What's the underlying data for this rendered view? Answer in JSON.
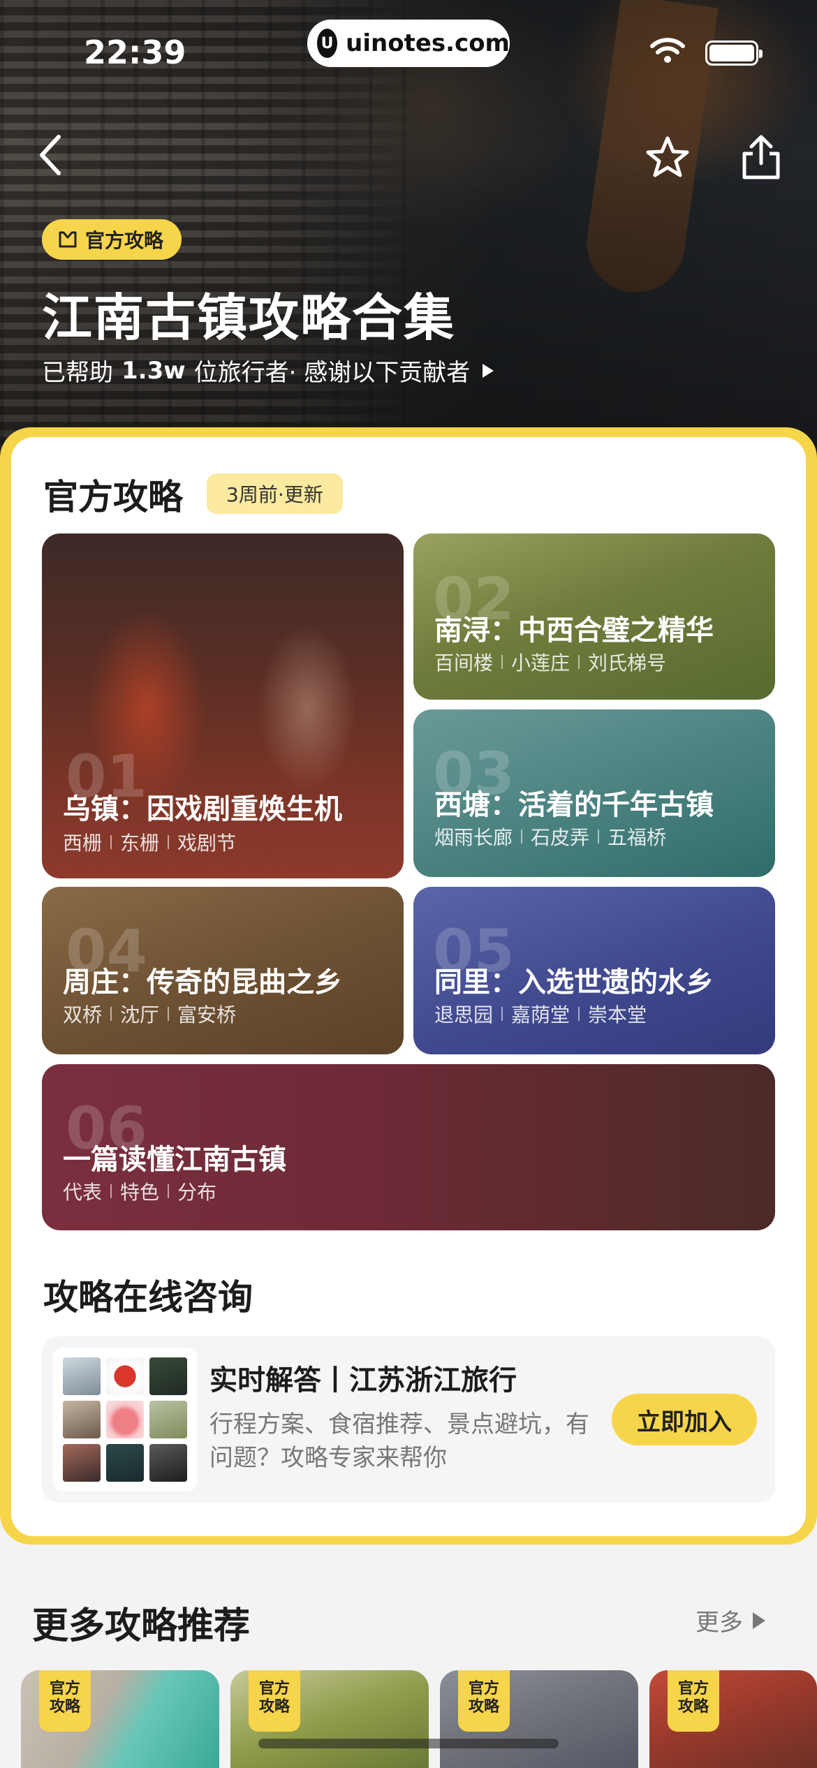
{
  "status_bar": {
    "time": "22:39",
    "url": "uinotes.com",
    "url_logo": "U"
  },
  "hero": {
    "badge_label": "官方攻略",
    "title": "江南古镇攻略合集",
    "subtitle_prefix": "已帮助",
    "subtitle_count": "1.3w",
    "subtitle_suffix": "位旅行者· 感谢以下贡献者"
  },
  "official": {
    "title": "官方攻略",
    "update_label": "3周前·更新",
    "guides": [
      {
        "num": "01",
        "title": "乌镇：因戏剧重焕生机",
        "tags": [
          "西栅",
          "东栅",
          "戏剧节"
        ]
      },
      {
        "num": "02",
        "title": "南浔：中西合璧之精华",
        "tags": [
          "百间楼",
          "小莲庄",
          "刘氏梯号"
        ]
      },
      {
        "num": "03",
        "title": "西塘：活着的千年古镇",
        "tags": [
          "烟雨长廊",
          "石皮弄",
          "五福桥"
        ]
      },
      {
        "num": "04",
        "title": "周庄：传奇的昆曲之乡",
        "tags": [
          "双桥",
          "沈厅",
          "富安桥"
        ]
      },
      {
        "num": "05",
        "title": "同里：入选世遗的水乡",
        "tags": [
          "退思园",
          "嘉荫堂",
          "崇本堂"
        ]
      },
      {
        "num": "06",
        "title": "一篇读懂江南古镇",
        "tags": [
          "代表",
          "特色",
          "分布"
        ]
      }
    ]
  },
  "consult": {
    "section_title": "攻略在线咨询",
    "title": "实时解答丨江苏浙江旅行",
    "desc": "行程方案、食宿推荐、景点避坑，有问题？攻略专家来帮你",
    "join_label": "立即加入"
  },
  "more": {
    "title": "更多攻略推荐",
    "more_label": "更多",
    "badge_line1": "官方",
    "badge_line2": "攻略"
  },
  "colors": {
    "accent": "#f7d54a",
    "update_pill": "#fbeaa0"
  },
  "icons": [
    "back-icon",
    "star-icon",
    "share-icon",
    "wifi-icon",
    "battery-icon",
    "guide-book-icon",
    "play-icon"
  ]
}
